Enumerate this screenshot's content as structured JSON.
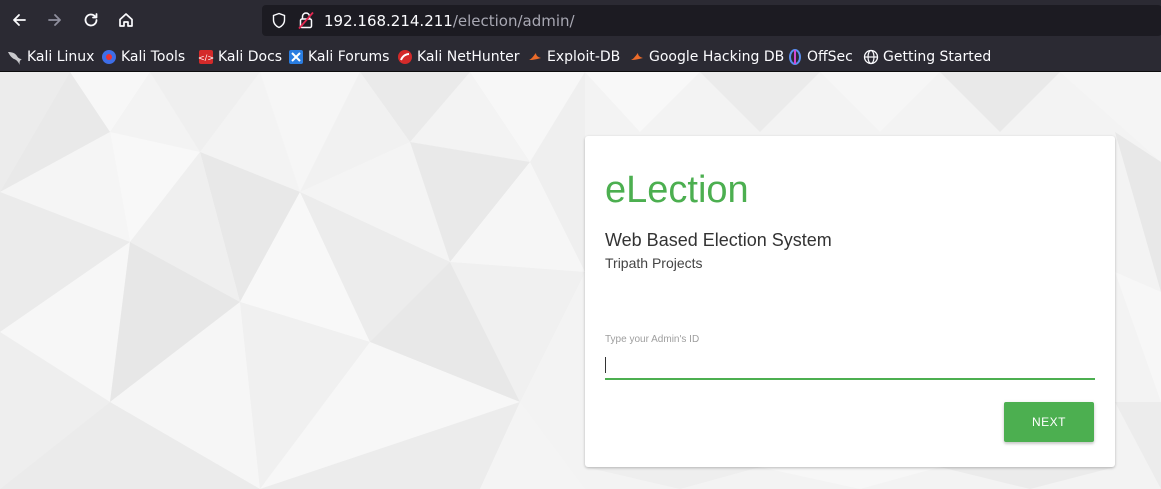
{
  "browser": {
    "url_host": "192.168.214.211",
    "url_path": "/election/admin/",
    "bookmarks": [
      {
        "label": "Kali Linux",
        "icon": "kali-dragon-icon"
      },
      {
        "label": "Kali Tools",
        "icon": "kali-tools-icon"
      },
      {
        "label": "Kali Docs",
        "icon": "kali-docs-icon"
      },
      {
        "label": "Kali Forums",
        "icon": "kali-forums-icon"
      },
      {
        "label": "Kali NetHunter",
        "icon": "kali-nethunter-icon"
      },
      {
        "label": "Exploit-DB",
        "icon": "exploit-db-icon"
      },
      {
        "label": "Google Hacking DB",
        "icon": "ghdb-icon"
      },
      {
        "label": "OffSec",
        "icon": "offsec-icon"
      },
      {
        "label": "Getting Started",
        "icon": "globe-icon"
      }
    ]
  },
  "login": {
    "brand": "eLection",
    "subtitle": "Web Based Election System",
    "organization": "Tripath Projects",
    "admin_id_label": "Type your Admin's ID",
    "admin_id_value": "",
    "next_label": "NEXT"
  },
  "colors": {
    "accent": "#4caf50",
    "chrome_bg": "#2b2a33",
    "urlbar_bg": "#1c1b22"
  }
}
